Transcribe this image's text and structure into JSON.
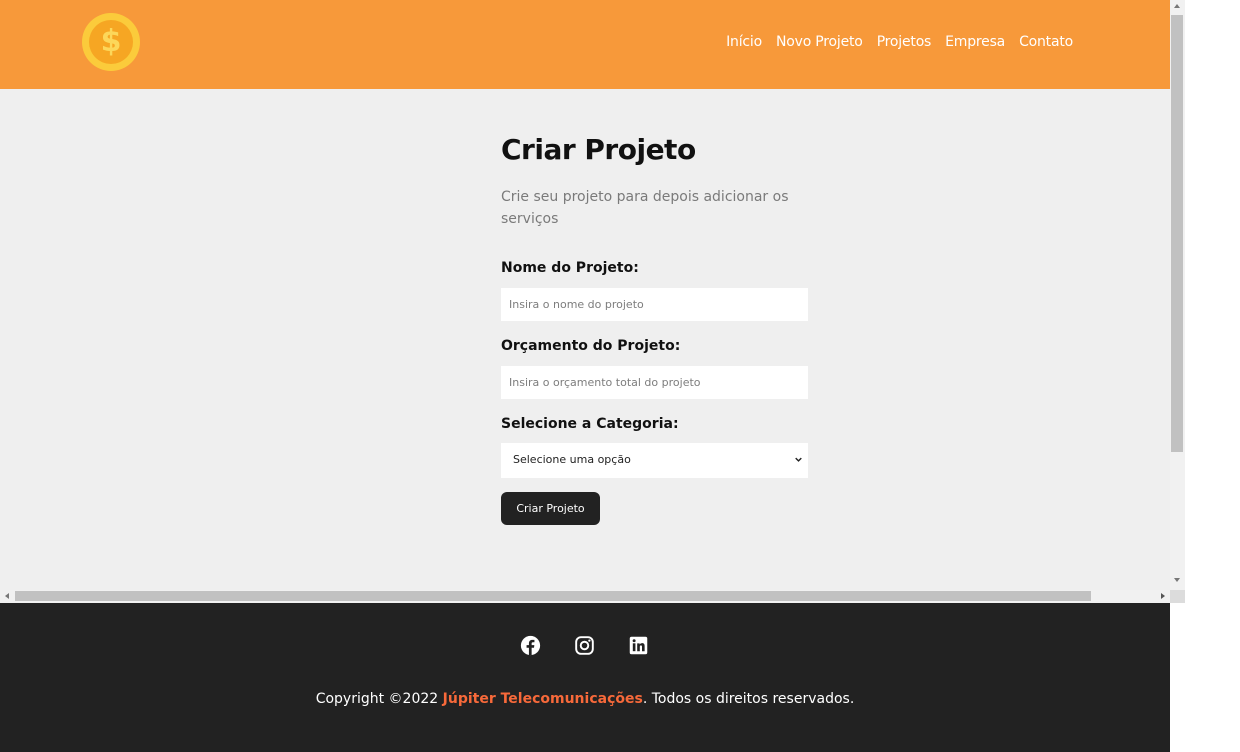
{
  "navbar": {
    "logo_symbol": "$",
    "links": [
      "Início",
      "Novo Projeto",
      "Projetos",
      "Empresa",
      "Contato"
    ]
  },
  "form": {
    "title": "Criar Projeto",
    "subtitle": "Crie seu projeto para depois adicionar os serviços",
    "name_label": "Nome do Projeto:",
    "name_placeholder": "Insira o nome do projeto",
    "budget_label": "Orçamento do Projeto:",
    "budget_placeholder": "Insira o orçamento total do projeto",
    "category_label": "Selecione a Categoria:",
    "category_selected": "Selecione uma opção",
    "submit_label": "Criar Projeto"
  },
  "footer": {
    "social_icons": [
      "facebook-icon",
      "instagram-icon",
      "linkedin-icon"
    ],
    "copyright_prefix": "Copyright ©2022 ",
    "company": "Júpiter Telecomunicações",
    "copyright_suffix": ". Todos os direitos reservados."
  },
  "colors": {
    "navbar": "#f7993a",
    "footer": "#222222",
    "brand_text": "#f7693a",
    "button": "#222222"
  }
}
